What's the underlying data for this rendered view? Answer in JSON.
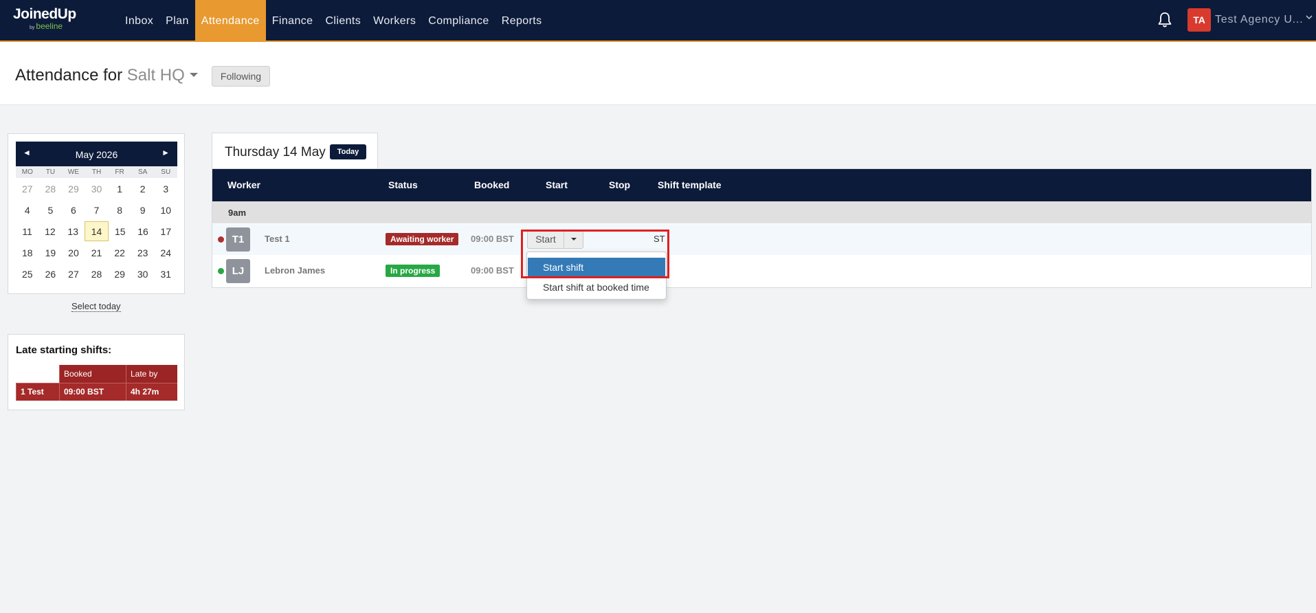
{
  "brand": {
    "name_main": "JoinedUp",
    "name_sub": "beeline",
    "name_by": "by"
  },
  "nav": {
    "items": [
      {
        "label": "Inbox",
        "active": false
      },
      {
        "label": "Plan",
        "active": false
      },
      {
        "label": "Attendance",
        "active": true
      },
      {
        "label": "Finance",
        "active": false
      },
      {
        "label": "Clients",
        "active": false
      },
      {
        "label": "Workers",
        "active": false
      },
      {
        "label": "Compliance",
        "active": false
      },
      {
        "label": "Reports",
        "active": false
      }
    ],
    "user_initials": "TA",
    "user_name": "Test Agency U..."
  },
  "header": {
    "title_prefix": "Attendance for",
    "location": "Salt HQ",
    "following_label": "Following"
  },
  "calendar": {
    "month_label": "May 2026",
    "prev": "◄",
    "next": "►",
    "weekdays": [
      "MO",
      "TU",
      "WE",
      "TH",
      "FR",
      "SA",
      "SU"
    ],
    "weeks": [
      [
        "27",
        "28",
        "29",
        "30",
        "1",
        "2",
        "3"
      ],
      [
        "4",
        "5",
        "6",
        "7",
        "8",
        "9",
        "10"
      ],
      [
        "11",
        "12",
        "13",
        "14",
        "15",
        "16",
        "17"
      ],
      [
        "18",
        "19",
        "20",
        "21",
        "22",
        "23",
        "24"
      ],
      [
        "25",
        "26",
        "27",
        "28",
        "29",
        "30",
        "31"
      ]
    ],
    "selected_day": "14",
    "select_today": "Select today"
  },
  "late_shifts": {
    "title": "Late starting shifts:",
    "columns": [
      "",
      "Booked",
      "Late by"
    ],
    "rows": [
      [
        "1 Test",
        "09:00 BST",
        "4h 27m"
      ]
    ]
  },
  "day_view": {
    "date_label": "Thursday 14 May",
    "today_label": "Today",
    "columns": [
      "Worker",
      "Status",
      "Booked",
      "Start",
      "Stop",
      "Shift template"
    ],
    "group_label": "9am",
    "rows": [
      {
        "initials": "T1",
        "name": "Test 1",
        "status": "Awaiting worker",
        "status_color": "#a52a2a",
        "dot_color": "#b03030",
        "booked": "09:00 BST",
        "start_label": "Start",
        "template": "ST"
      },
      {
        "initials": "LJ",
        "name": "Lebron James",
        "status": "In progress",
        "status_color": "#27a844",
        "dot_color": "#27a844",
        "booked": "09:00 BST"
      }
    ],
    "dropdown": [
      "Start shift",
      "Start shift at booked time"
    ]
  },
  "colors": {
    "nav_bg": "#0d1b3a",
    "accent": "#e8992f",
    "danger": "#a52a2a",
    "success": "#27a844",
    "highlight": "#337ab7"
  }
}
